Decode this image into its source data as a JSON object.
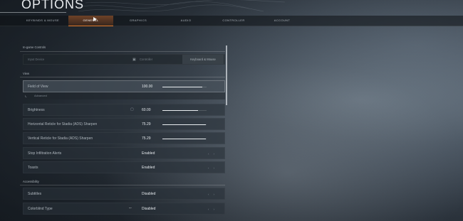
{
  "page": {
    "title": "OPTIONS"
  },
  "tabs": [
    {
      "label": "KEYBINDS & MOUSE",
      "active": false
    },
    {
      "label": "GENERAL",
      "active": true
    },
    {
      "label": "GRAPHICS",
      "active": false
    },
    {
      "label": "AUDIO",
      "active": false
    },
    {
      "label": "CONTROLLER",
      "active": false
    },
    {
      "label": "ACCOUNT",
      "active": false
    }
  ],
  "input_section": {
    "label": "In-game Controls",
    "field_label": "Input Device",
    "option_controller": "Controller",
    "option_kbm": "Keyboard & Mouse"
  },
  "view_section": {
    "label": "View"
  },
  "fov": {
    "label": "Field of View",
    "value": "100.00",
    "fraction": 0.9
  },
  "advanced": {
    "label": "Advanced"
  },
  "brightness": {
    "label": "Brightness",
    "value": "60.00",
    "fraction": 0.8
  },
  "h_sens": {
    "label": "Horizontal Reticle for Stadia (ADS) Sharpen",
    "value": "75.29",
    "fraction": 0.98
  },
  "v_sens": {
    "label": "Vertical Reticle for Stadia (ADS) Sharpen",
    "value": "75.29",
    "fraction": 0.98
  },
  "stop_infinite": {
    "label": "Stop Infiltration Alerts",
    "value": "Enabled"
  },
  "toasts": {
    "label": "Toasts",
    "value": "Enabled"
  },
  "accessibility_section": {
    "label": "Accessibility"
  },
  "subtitles": {
    "label": "Subtitles",
    "value": "Disabled"
  },
  "colorblind": {
    "label": "Colorblind Type",
    "value": "Disabled"
  },
  "colors": {
    "accent": "#e07a2d"
  }
}
